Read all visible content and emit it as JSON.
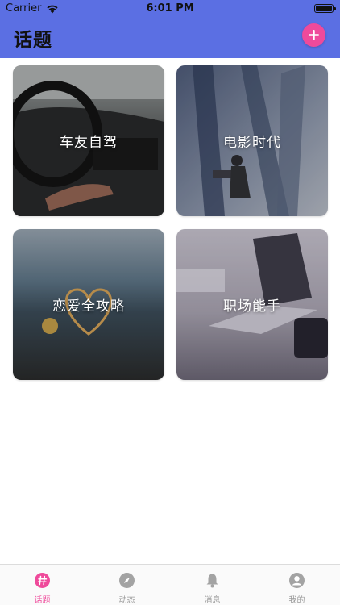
{
  "status_bar": {
    "carrier": "Carrier",
    "time": "6:01 PM"
  },
  "header": {
    "title": "话题",
    "add_icon": "plus-icon"
  },
  "colors": {
    "header_bg": "#5b6fe3",
    "accent": "#ef4a9b",
    "tab_inactive": "#9a9a9a"
  },
  "topics": [
    {
      "label": "车友自驾",
      "image": "car-interior-photo"
    },
    {
      "label": "电影时代",
      "image": "cinema-poster-photo"
    },
    {
      "label": "恋爱全攻略",
      "image": "heart-lights-photo"
    },
    {
      "label": "职场能手",
      "image": "laptop-desk-photo"
    }
  ],
  "tabbar": {
    "active": 0,
    "tabs": [
      {
        "label": "话题",
        "icon": "topic-hash-icon"
      },
      {
        "label": "动态",
        "icon": "compass-icon"
      },
      {
        "label": "消息",
        "icon": "bell-icon"
      },
      {
        "label": "我的",
        "icon": "profile-icon"
      }
    ]
  }
}
